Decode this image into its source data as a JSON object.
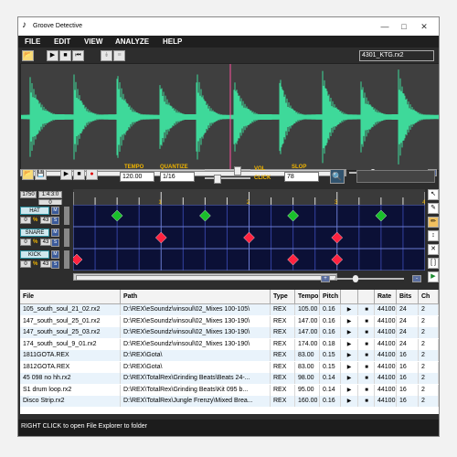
{
  "window": {
    "title": "Groove Detective"
  },
  "menu": [
    "FILE",
    "EDIT",
    "VIEW",
    "ANALYZE",
    "HELP"
  ],
  "wave_toolbar": {
    "filename": "4301_KTG.rx2"
  },
  "colors": {
    "wave": "#3ed99a",
    "grid": "#0b1036",
    "hat": "#19c02a",
    "snare_kick": "#ff2340",
    "cursor": "#ff4f9c",
    "accent": "#f0b400"
  },
  "controls": {
    "tempo_label": "TEMPO",
    "tempo_value": "120.00",
    "quantize_label": "QUANTIZE",
    "quantize_value": "1/16",
    "vol_label": "VOL",
    "click_label": "CLICK",
    "slop_label": "SLOP",
    "slop_value": "78"
  },
  "position": {
    "bar": "1750",
    "beat": "1:4:3:0",
    "sub": "0"
  },
  "ruler": {
    "marks": [
      "1",
      "2",
      "3",
      "4"
    ]
  },
  "tracks": [
    {
      "name": "HAT",
      "vol": "0",
      "unit": "%",
      "val": "43",
      "hits": [
        0.5,
        1.5,
        2.5,
        3.5
      ]
    },
    {
      "name": "SNARE",
      "vol": "0",
      "unit": "%",
      "val": "43",
      "hits": [
        1.0,
        2.0,
        3.0
      ]
    },
    {
      "name": "KICK",
      "vol": "0",
      "unit": "%",
      "val": "43",
      "hits": [
        0.0,
        2.5,
        3.0
      ]
    }
  ],
  "table": {
    "headers": [
      "File",
      "Path",
      "Type",
      "Tempo",
      "Pitch",
      "",
      "",
      "Rate",
      "Bits",
      "Ch"
    ],
    "rows": [
      [
        "105_south_soul_21_02.rx2",
        "D:\\REX\\eSoundz\\vinsoul\\02_Mixes 100-105\\",
        "REX",
        "105.00",
        "0.16",
        "44100",
        "24",
        "2"
      ],
      [
        "147_south_soul_25_01.rx2",
        "D:\\REX\\eSoundz\\vinsoul\\02_Mixes 130-190\\",
        "REX",
        "147.00",
        "0.16",
        "44100",
        "24",
        "2"
      ],
      [
        "147_south_soul_25_03.rx2",
        "D:\\REX\\eSoundz\\vinsoul\\02_Mixes 130-190\\",
        "REX",
        "147.00",
        "0.16",
        "44100",
        "24",
        "2"
      ],
      [
        "174_south_soul_9_01.rx2",
        "D:\\REX\\eSoundz\\vinsoul\\02_Mixes 130-190\\",
        "REX",
        "174.00",
        "0.18",
        "44100",
        "24",
        "2"
      ],
      [
        "1811GOTA.REX",
        "D:\\REX\\Gota\\",
        "REX",
        "83.00",
        "0.15",
        "44100",
        "16",
        "2"
      ],
      [
        "1812GOTA.REX",
        "D:\\REX\\Gota\\",
        "REX",
        "83.00",
        "0.15",
        "44100",
        "16",
        "2"
      ],
      [
        "45 098 no hh.rx2",
        "D:\\REX\\TotalRex\\Grinding Beats\\Beats 24-...",
        "REX",
        "98.00",
        "0.14",
        "44100",
        "16",
        "2"
      ],
      [
        "S1 drum loop.rx2",
        "D:\\REX\\TotalRex\\Grinding Beats\\Kit 095 b...",
        "REX",
        "95.00",
        "0.14",
        "44100",
        "16",
        "2"
      ],
      [
        "Disco Strip.rx2",
        "D:\\REX\\TotalRex\\Jungle Frenzy\\Mixed Brea...",
        "REX",
        "160.00",
        "0.16",
        "44100",
        "16",
        "2"
      ]
    ]
  },
  "status": {
    "text": "RIGHT CLICK to open File Explorer to folder"
  }
}
